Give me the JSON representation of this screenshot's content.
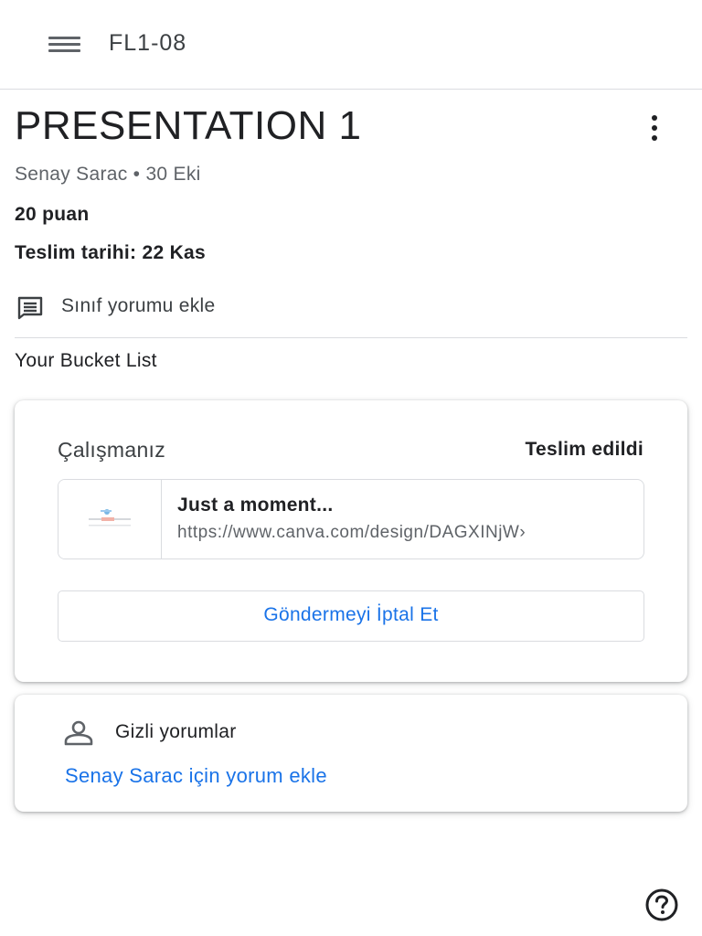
{
  "header": {
    "menu_icon": "hamburger-menu-icon",
    "course_name": "FL1-08"
  },
  "assignment": {
    "title": "PRESENTATION 1",
    "more_icon": "more-vertical-icon",
    "meta": "Senay Sarac • 30 Eki",
    "points": "20 puan",
    "due": "Teslim tarihi: 22 Kas",
    "class_comment_icon": "comment-icon",
    "class_comment_label": "Sınıf yorumu ekle",
    "description": "Your Bucket List"
  },
  "your_work": {
    "title": "Çalışmanız",
    "status": "Teslim edildi",
    "attachment": {
      "thumbnail_icon": "canva-thumbnail",
      "title": "Just a moment...",
      "url": "https://www.canva.com/design/DAGXINjW›"
    },
    "unsubmit_label": "Göndermeyi İptal Et"
  },
  "private_comments": {
    "icon": "person-icon",
    "title": "Gizli yorumlar",
    "add_label": "Senay Sarac için yorum ekle"
  },
  "help": {
    "icon": "help-circle-icon"
  },
  "colors": {
    "accent_blue": "#1a73e8",
    "text_primary": "#202124",
    "text_secondary": "#5f6368",
    "divider": "#dadce0"
  }
}
